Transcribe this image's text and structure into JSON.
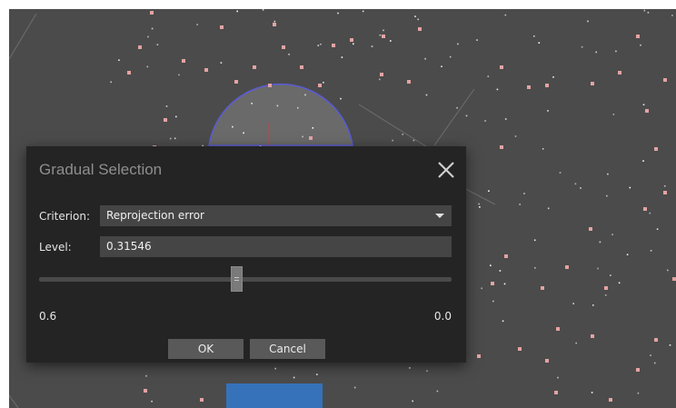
{
  "dialog": {
    "title": "Gradual Selection",
    "close_icon": "close-icon",
    "criterion": {
      "label": "Criterion:",
      "selected": "Reprojection error"
    },
    "level": {
      "label": "Level:",
      "value": "0.31546"
    },
    "slider": {
      "min_label": "0.6",
      "max_label": "0.0",
      "position_fraction": 0.48
    },
    "buttons": {
      "ok": "OK",
      "cancel": "Cancel"
    }
  },
  "colors": {
    "viewport_bg": "#4b4b4b",
    "dialog_bg": "#242424",
    "field_bg": "#454545",
    "button_bg": "#595959",
    "point_pink": "#e3a3a3",
    "point_white": "#ffffff",
    "sphere_outline": "#5b5bd6",
    "blue_block": "#3672b9"
  }
}
